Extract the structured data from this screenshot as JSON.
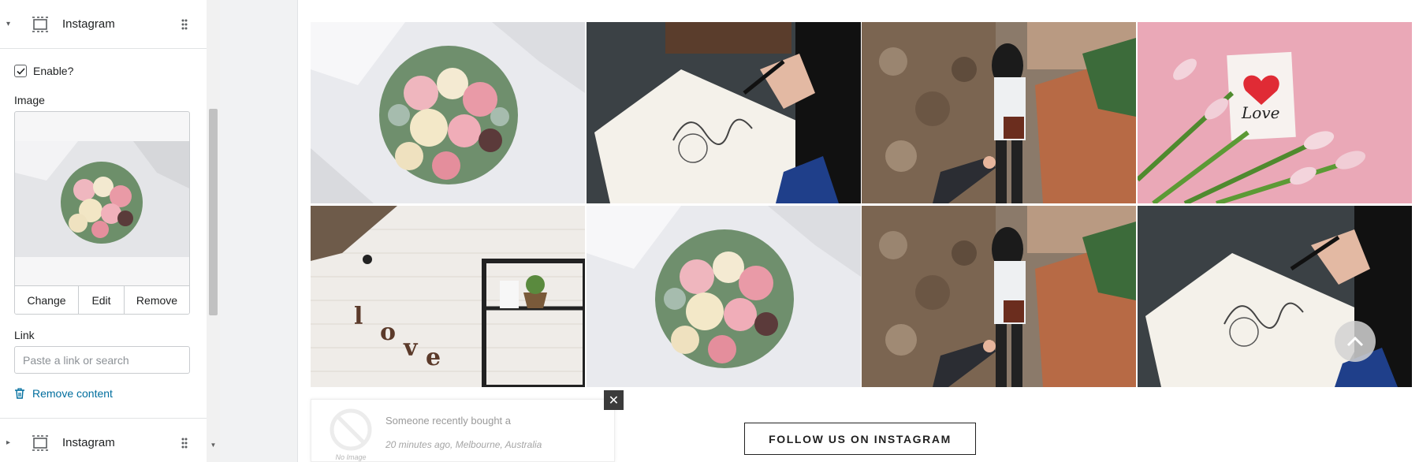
{
  "sidebar": {
    "section_top": {
      "title": "Instagram",
      "caret": "▾",
      "icon": "section-layout-icon"
    },
    "enable": {
      "label": "Enable?",
      "checked": true
    },
    "image": {
      "label": "Image",
      "buttons": {
        "change": "Change",
        "edit": "Edit",
        "remove": "Remove"
      }
    },
    "link": {
      "label": "Link",
      "placeholder": "Paste a link or search"
    },
    "remove_content": "Remove content",
    "section_bottom": {
      "title": "Instagram",
      "caret": "▸",
      "icon": "section-layout-icon"
    }
  },
  "preview": {
    "photos": [
      {
        "subject": "bouquet",
        "icon": "flower-bouquet-photo"
      },
      {
        "subject": "notebook-writing",
        "icon": "notebook-writing-photo"
      },
      {
        "subject": "couple-holding-hands",
        "icon": "couple-hands-photo"
      },
      {
        "subject": "tulips-love-card",
        "icon": "tulips-love-card-photo"
      },
      {
        "subject": "love-letters-on-wall",
        "icon": "love-wall-photo"
      },
      {
        "subject": "bouquet",
        "icon": "flower-bouquet-photo"
      },
      {
        "subject": "couple-holding-hands",
        "icon": "couple-hands-photo"
      },
      {
        "subject": "notebook-writing",
        "icon": "notebook-writing-photo"
      }
    ],
    "photo_texts": {
      "love_card": "Love",
      "love_wall": [
        "l",
        "o",
        "v",
        "e"
      ]
    },
    "popup": {
      "line1": "Someone recently bought a",
      "line2": "20 minutes ago, Melbourne, Australia",
      "no_image": "No Image",
      "close": "✕"
    },
    "follow_button": "FOLLOW US ON INSTAGRAM",
    "scroll_top_icon": "chevron-up-icon"
  }
}
